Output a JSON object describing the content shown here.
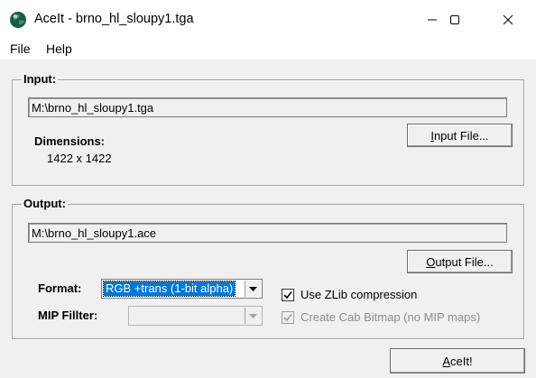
{
  "window": {
    "title": "AceIt - brno_hl_sloupy1.tga",
    "icon": "globe-app-icon"
  },
  "menu": {
    "file": "File",
    "help": "Help"
  },
  "input_group": {
    "label": "Input:",
    "path": "M:\\brno_hl_sloupy1.tga",
    "dimensions_label": "Dimensions:",
    "dimensions_value": "1422 x 1422",
    "button_pre": "",
    "button_u": "I",
    "button_post": "nput File..."
  },
  "output_group": {
    "label": "Output:",
    "path": "M:\\brno_hl_sloupy1.ace",
    "button_pre": "",
    "button_u": "O",
    "button_post": "utput File...",
    "format_label": "Format:",
    "format_value": "RGB +trans (1-bit alpha)",
    "mip_label": "MIP Fillter:",
    "mip_value": "",
    "zlib_label": "Use ZLib compression",
    "zlib_checked": true,
    "cab_label": "Create Cab Bitmap (no MIP maps)",
    "cab_checked": true,
    "cab_disabled": true
  },
  "aceit_button": {
    "pre": "",
    "u": "A",
    "post": "ceIt!"
  },
  "colors": {
    "selection": "#0078d7",
    "group_border": "#a0a0a0",
    "background": "#f0f0f0"
  }
}
